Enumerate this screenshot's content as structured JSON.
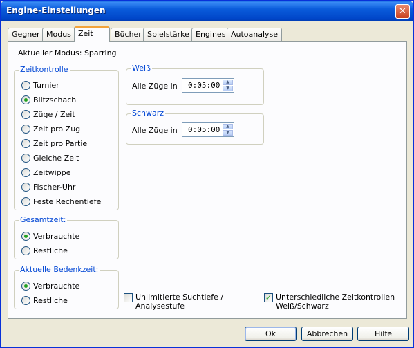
{
  "window": {
    "title": "Engine-Einstellungen",
    "close_glyph": "✕"
  },
  "tabs": [
    {
      "label": "Gegner"
    },
    {
      "label": "Modus"
    },
    {
      "label": "Zeit"
    },
    {
      "label": "Bücher"
    },
    {
      "label": "Spielstärke"
    },
    {
      "label": "Engines"
    },
    {
      "label": "Autoanalyse"
    }
  ],
  "active_tab": "Zeit",
  "mode_text": "Aktueller Modus: Sparring",
  "zeitkontrolle": {
    "legend": "Zeitkontrolle",
    "options": [
      {
        "label": "Turnier",
        "selected": false
      },
      {
        "label": "Blitzschach",
        "selected": true
      },
      {
        "label": "Züge / Zeit",
        "selected": false
      },
      {
        "label": "Zeit pro Zug",
        "selected": false
      },
      {
        "label": "Zeit pro Partie",
        "selected": false
      },
      {
        "label": "Gleiche Zeit",
        "selected": false
      },
      {
        "label": "Zeitwippe",
        "selected": false
      },
      {
        "label": "Fischer-Uhr",
        "selected": false
      },
      {
        "label": "Feste Rechentiefe",
        "selected": false
      }
    ]
  },
  "gesamtzeit": {
    "legend": "Gesamtzeit:",
    "options": [
      {
        "label": "Verbrauchte",
        "selected": true
      },
      {
        "label": "Restliche",
        "selected": false
      }
    ]
  },
  "bedenkzeit": {
    "legend": "Aktuelle Bedenkzeit:",
    "options": [
      {
        "label": "Verbrauchte",
        "selected": true
      },
      {
        "label": "Restliche",
        "selected": false
      }
    ]
  },
  "weiss": {
    "legend": "Weiß",
    "label": "Alle Züge in",
    "value": "0:05:00"
  },
  "schwarz": {
    "legend": "Schwarz",
    "label": "Alle Züge in",
    "value": "0:05:00"
  },
  "checkboxes": {
    "unlimited": {
      "line1": "Unlimitierte Suchtiefe /",
      "line2": "Analysestufe",
      "checked": false
    },
    "different": {
      "line1": "Unterschiedliche Zeitkontrollen",
      "line2": "Weiß/Schwarz",
      "checked": true
    }
  },
  "buttons": {
    "ok": "Ok",
    "cancel": "Abbrechen",
    "help": "Hilfe"
  }
}
